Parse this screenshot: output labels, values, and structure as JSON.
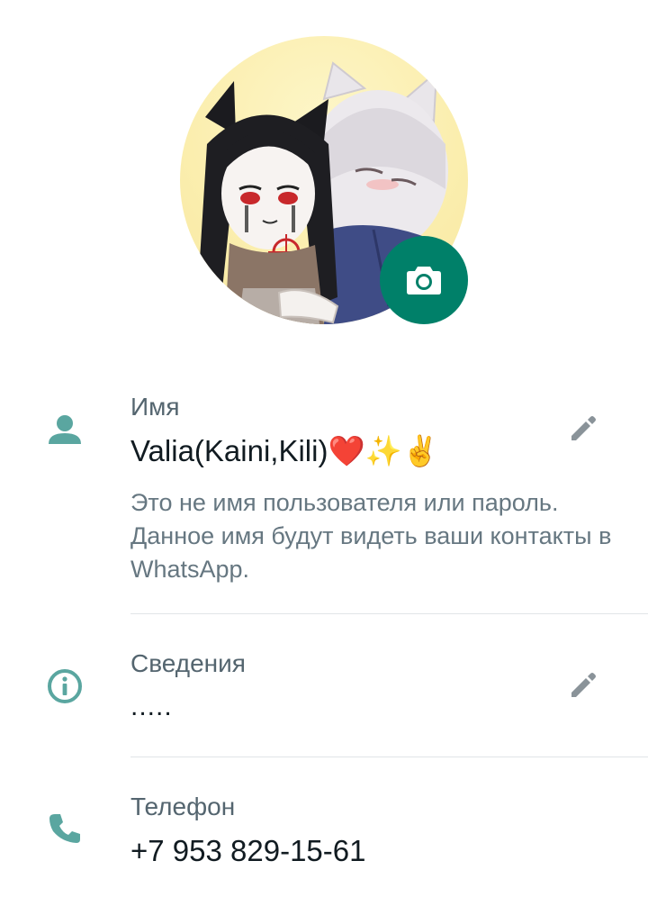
{
  "profile": {
    "avatar_alt": "profile photo",
    "camera_icon": "camera-icon"
  },
  "name_row": {
    "icon": "person-icon",
    "label": "Имя",
    "value": "Valia(Kaini,Kili)❤️✨✌️",
    "hint": "Это не имя пользователя или пароль. Данное имя будут видеть ваши контакты в WhatsApp.",
    "edit_icon": "pencil-icon"
  },
  "about_row": {
    "icon": "info-icon",
    "label": "Сведения",
    "value": ".....",
    "edit_icon": "pencil-icon"
  },
  "phone_row": {
    "icon": "phone-icon",
    "label": "Телефон",
    "value": "+7 953 829-15-61"
  },
  "colors": {
    "accent": "#008069",
    "icon_teal": "#5aa6a0",
    "icon_gray": "#8a9399",
    "label_gray": "#54656f"
  }
}
